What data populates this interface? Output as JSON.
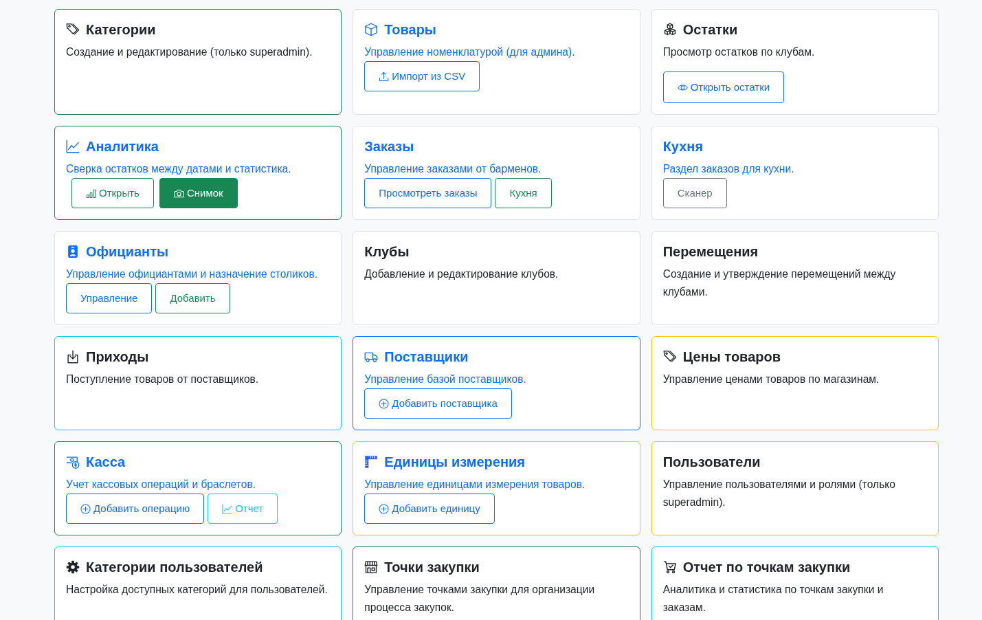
{
  "cards": [
    {
      "title": "Категории",
      "description": "Создание и редактирование (только superadmin).",
      "link": false,
      "color": "#198754"
    },
    {
      "title": "Товары",
      "description": "Управление номенклатурой (для админа).",
      "link": true,
      "color": "#dee2e6",
      "buttons": [
        {
          "label": "Импорт из CSV",
          "color": "#0d6efd",
          "filled": false
        }
      ]
    },
    {
      "title": "Остатки",
      "description": "Просмотр остатков по клубам.",
      "link": false,
      "color": "#dee2e6",
      "buttons": [
        {
          "label": "Открыть остатки",
          "color": "#0d6efd",
          "filled": false
        }
      ]
    },
    {
      "title": "Аналитика",
      "description": "Сверка остатков между датами и статистика.",
      "link": true,
      "color": "#198754",
      "buttons": [
        {
          "label": "Открыть",
          "color": "#198754",
          "filled": false
        },
        {
          "label": "Снимок",
          "color": "#198754",
          "filled": true
        }
      ]
    },
    {
      "title": "Заказы",
      "description": "Управление заказами от барменов.",
      "link": true,
      "color": "#dee2e6",
      "buttons": [
        {
          "label": "Просмотреть заказы",
          "color": "#0d6efd",
          "filled": false
        },
        {
          "label": "Кухня",
          "color": "#198754",
          "filled": false
        }
      ]
    },
    {
      "title": "Кухня",
      "description": "Раздел заказов для кухни.",
      "link": true,
      "color": "#dee2e6",
      "buttons": [
        {
          "label": "Сканер",
          "color": "#6c757d",
          "filled": false
        }
      ]
    },
    {
      "title": "Официанты",
      "description": "Управление официантами и назначение столиков.",
      "link": true,
      "color": "#dee2e6",
      "buttons": [
        {
          "label": "Управление",
          "color": "#0d6efd",
          "filled": false
        },
        {
          "label": "Добавить",
          "color": "#198754",
          "filled": false
        }
      ]
    },
    {
      "title": "Клубы",
      "description": "Добавление и редактирование клубов.",
      "link": false,
      "color": "#dee2e6"
    },
    {
      "title": "Перемещения",
      "description": "Создание и утверждение перемещений между клубами.",
      "link": false,
      "color": "#dee2e6"
    },
    {
      "title": "Приходы",
      "description": "Поступление товаров от поставщиков.",
      "link": false,
      "color": "#0dcaf0"
    },
    {
      "title": "Поставщики",
      "description": "Управление базой поставщиков.",
      "link": true,
      "color": "#0d6efd",
      "buttons": [
        {
          "label": "Добавить поставщика",
          "color": "#0d6efd",
          "filled": false
        }
      ]
    },
    {
      "title": "Цены товаров",
      "description": "Управление ценами товаров по магазинам.",
      "link": false,
      "color": "#ffc107"
    },
    {
      "title": "Касса",
      "description": "Учет кассовых операций и браслетов.",
      "link": true,
      "color": "#198754",
      "buttons": [
        {
          "label": "Добавить операцию",
          "color": "#0d6efd",
          "filled": false
        },
        {
          "label": "Отчет",
          "color": "#0dcaf0",
          "filled": false
        }
      ]
    },
    {
      "title": "Единицы измерения",
      "description": "Управление единицами измерения товаров.",
      "link": true,
      "color": "#ffc107",
      "buttons": [
        {
          "label": "Добавить единицу",
          "color": "#0d6efd",
          "filled": false
        }
      ]
    },
    {
      "title": "Пользователи",
      "description": "Управление пользователями и ролями (только superadmin).",
      "link": false,
      "color": "#ffc107"
    },
    {
      "title": "Категории пользователей",
      "description": "Настройка доступных категорий для пользователей.",
      "link": false,
      "color": "#0dcaf0"
    },
    {
      "title": "Точки закупки",
      "description": "Управление точками закупки для организации процесса закупок.",
      "link": false,
      "color": "#198754"
    },
    {
      "title": "Отчет по точкам закупки",
      "description": "Аналитика и статистика по точкам закупки и заказам.",
      "link": false,
      "color": "#0dcaf0"
    }
  ]
}
